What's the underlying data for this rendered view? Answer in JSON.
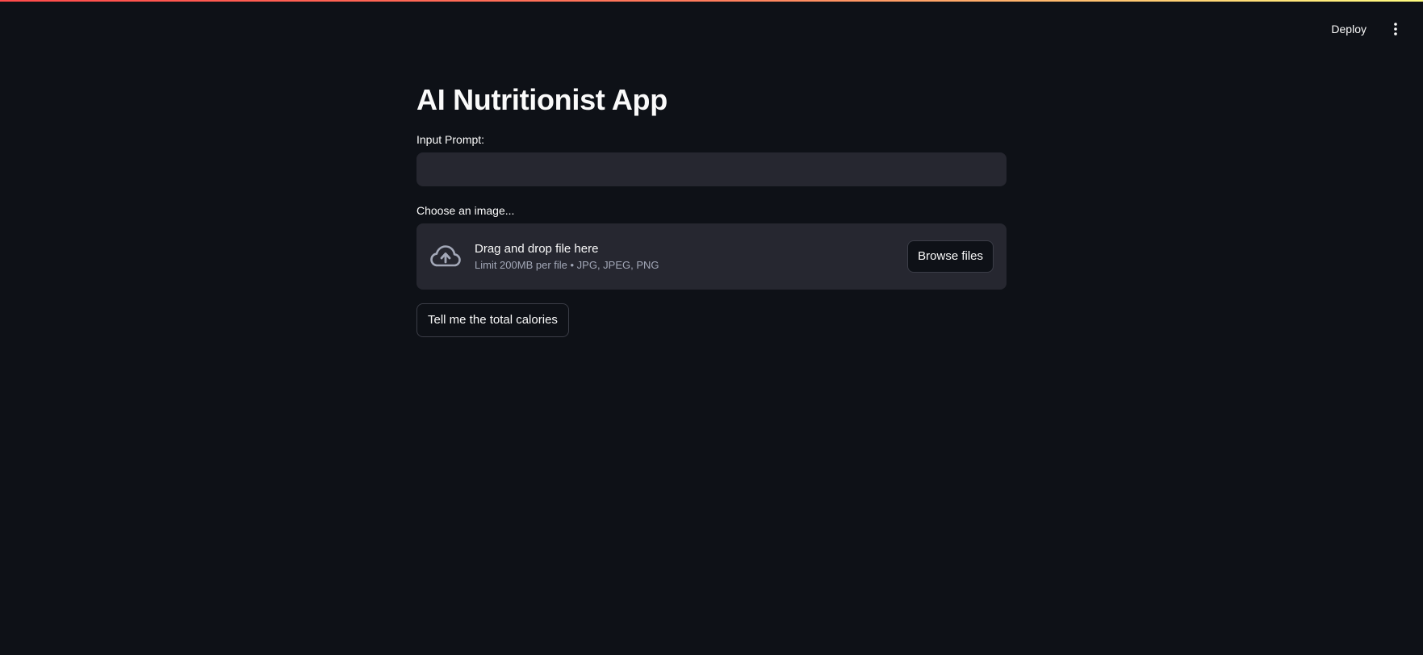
{
  "header": {
    "deploy_label": "Deploy",
    "menu_icon": "kebab-vertical-icon"
  },
  "main": {
    "title": "AI Nutritionist App",
    "prompt": {
      "label": "Input Prompt:",
      "value": "",
      "placeholder": ""
    },
    "uploader": {
      "label": "Choose an image...",
      "icon": "cloud-upload-icon",
      "title": "Drag and drop file here",
      "limit": "Limit 200MB per file • JPG, JPEG, PNG",
      "browse_label": "Browse files"
    },
    "submit_label": "Tell me the total calories"
  },
  "colors": {
    "background": "#0e1117",
    "input_bg": "#262730",
    "text": "#fafafa",
    "muted_text": "#a3a8b8",
    "accent_gradient_start": "#ff4b4b",
    "accent_gradient_end": "#fffd80"
  }
}
